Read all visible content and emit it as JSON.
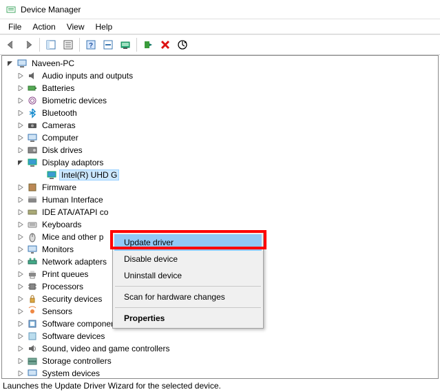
{
  "window": {
    "title": "Device Manager"
  },
  "menu": {
    "file": "File",
    "action": "Action",
    "view": "View",
    "help": "Help"
  },
  "tree": {
    "root": "Naveen-PC",
    "categories": [
      "Audio inputs and outputs",
      "Batteries",
      "Biometric devices",
      "Bluetooth",
      "Cameras",
      "Computer",
      "Disk drives",
      "Display adaptors",
      "Firmware",
      "Human Interface",
      "IDE ATA/ATAPI co",
      "Keyboards",
      "Mice and other p",
      "Monitors",
      "Network adapters",
      "Print queues",
      "Processors",
      "Security devices",
      "Sensors",
      "Software components",
      "Software devices",
      "Sound, video and game controllers",
      "Storage controllers",
      "System devices"
    ],
    "display_child": "Intel(R) UHD G"
  },
  "context_menu": {
    "update": "Update driver",
    "disable": "Disable device",
    "uninstall": "Uninstall device",
    "scan": "Scan for hardware changes",
    "properties": "Properties"
  },
  "statusbar": "Launches the Update Driver Wizard for the selected device."
}
